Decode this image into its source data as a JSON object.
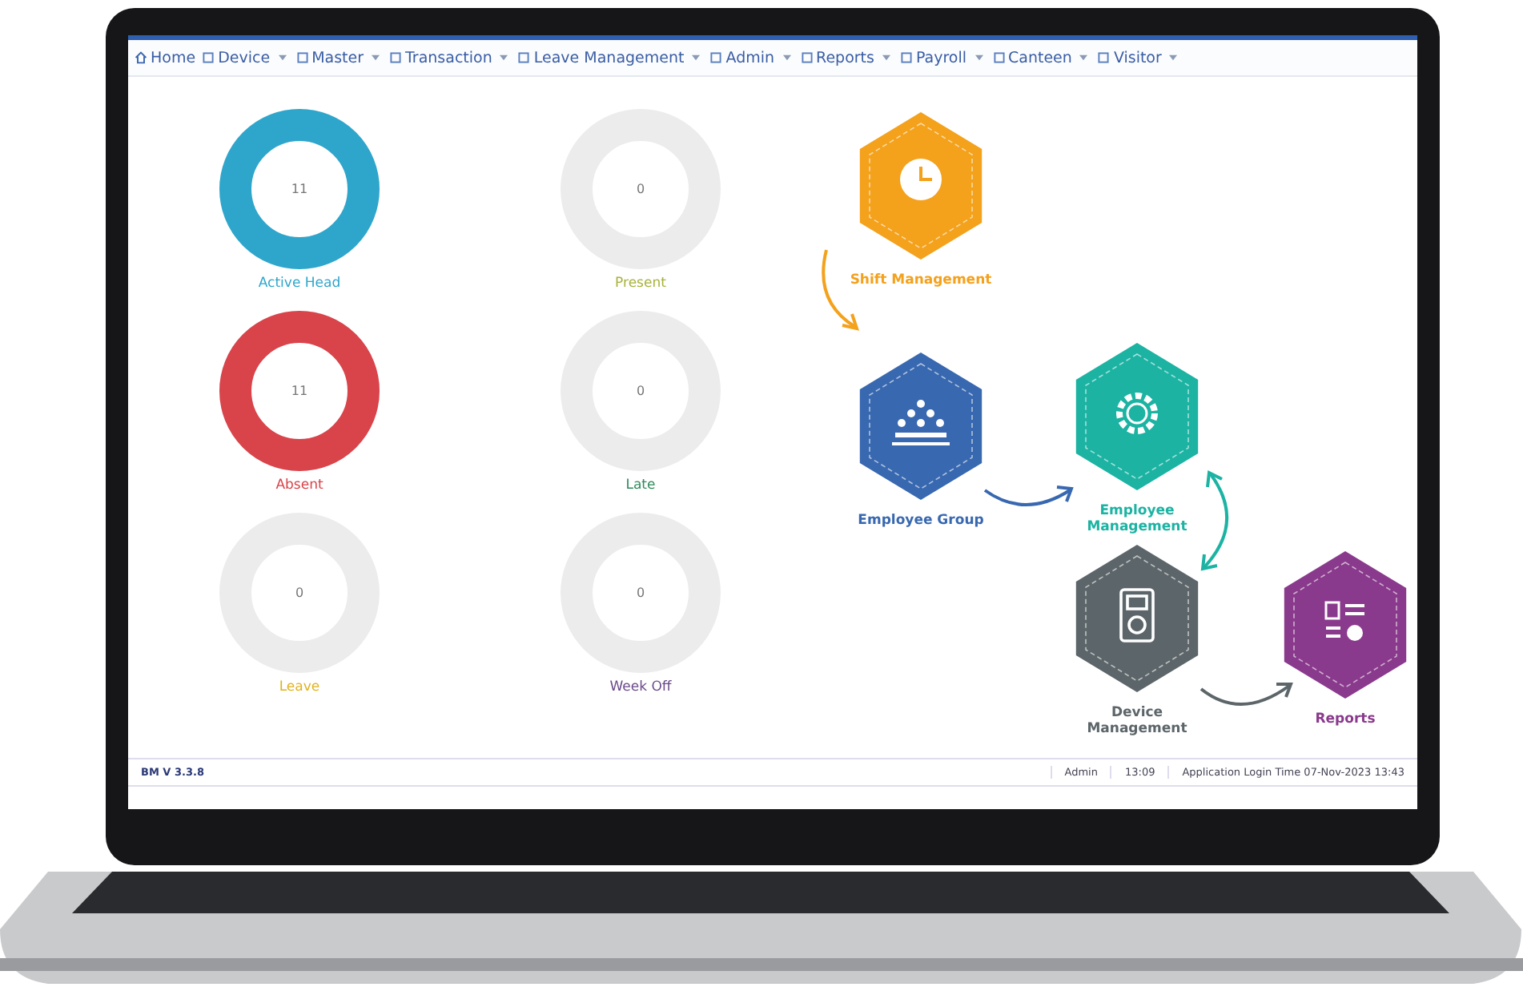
{
  "menu": [
    {
      "label": "Home",
      "dropdown": false
    },
    {
      "label": "Device",
      "dropdown": true
    },
    {
      "label": "Master",
      "dropdown": true
    },
    {
      "label": "Transaction",
      "dropdown": true
    },
    {
      "label": "Leave Management",
      "dropdown": true
    },
    {
      "label": "Admin",
      "dropdown": true
    },
    {
      "label": "Reports",
      "dropdown": true
    },
    {
      "label": "Payroll",
      "dropdown": true
    },
    {
      "label": "Canteen",
      "dropdown": true
    },
    {
      "label": "Visitor",
      "dropdown": true
    }
  ],
  "stats": [
    {
      "value": "11",
      "label": "Active Head",
      "color": "#2ea6cc",
      "level": 1
    },
    {
      "value": "0",
      "label": "Present",
      "color": "#a8b23a",
      "level": 0
    },
    {
      "value": "11",
      "label": "Absent",
      "color": "#d9434a",
      "level": 1
    },
    {
      "value": "0",
      "label": "Late",
      "color": "#2e8a5a",
      "level": 0
    },
    {
      "value": "0",
      "label": "Leave",
      "color": "#e0b21e",
      "level": 0
    },
    {
      "value": "0",
      "label": "Week Off",
      "color": "#6a4a8a",
      "level": 0
    }
  ],
  "flow": [
    {
      "label": "Shift Management",
      "color": "#f4a11c"
    },
    {
      "label": "Employee Group",
      "color": "#3868b0"
    },
    {
      "label": "Employee Management",
      "color": "#1cb3a3"
    },
    {
      "label": "Device Management",
      "color": "#5c6569"
    },
    {
      "label": "Reports",
      "color": "#8a3a8c"
    }
  ],
  "status_bar": {
    "version": "BM V 3.3.8",
    "user": "Admin",
    "time": "13:09",
    "login": "Application Login Time 07-Nov-2023 13:43"
  }
}
